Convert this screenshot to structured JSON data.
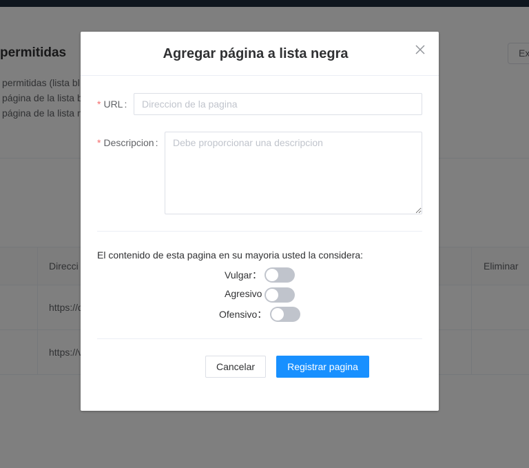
{
  "background": {
    "title": "permitidas",
    "export_label": "Ex",
    "lines": [
      "permitidas (lista bl",
      "página de la lista b",
      "página de la lista n"
    ],
    "table": {
      "headers": [
        "Direcci",
        "Eliminar"
      ],
      "rows": [
        "https://d",
        "https://v"
      ]
    }
  },
  "dialog": {
    "title": "Agregar página a lista negra",
    "close_icon": "close-icon",
    "url": {
      "label": "URL",
      "placeholder": "Direccion de la pagina",
      "value": ""
    },
    "description": {
      "label": "Descripcion",
      "placeholder": "Debe proporcionar una descripcion",
      "value": ""
    },
    "question": "El contenido de esta pagina en su mayoria usted la considera:",
    "toggles": [
      {
        "label": "Vulgar",
        "colon": "：",
        "on": false
      },
      {
        "label": "Agresivo",
        "colon": "",
        "on": false
      },
      {
        "label": "Ofensivo",
        "colon": "：",
        "on": false
      }
    ],
    "buttons": {
      "cancel": "Cancelar",
      "submit": "Registrar pagina"
    }
  },
  "colors": {
    "primary": "#1890ff",
    "required": "#f56c6c",
    "switch_off": "#c0c4cc",
    "topbar": "#1f2d3d"
  }
}
